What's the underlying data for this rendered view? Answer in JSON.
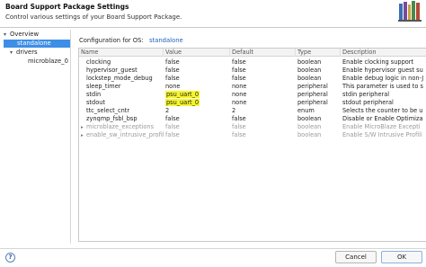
{
  "header": {
    "title": "Board Support Package Settings",
    "subtitle": "Control various settings of your Board Support Package.",
    "logo_icon": "books-stack-icon"
  },
  "tree": {
    "items": [
      {
        "label": "Overview",
        "level": 0,
        "expanded": true
      },
      {
        "label": "standalone",
        "level": 1,
        "selected": true
      },
      {
        "label": "drivers",
        "level": 1,
        "expanded": true
      },
      {
        "label": "microblaze_0",
        "level": 2
      }
    ]
  },
  "config": {
    "label": "Configuration for OS:",
    "value": "standalone"
  },
  "table": {
    "columns": [
      "Name",
      "Value",
      "Default",
      "Type",
      "Description"
    ],
    "rows": [
      {
        "name": "clocking",
        "value": "false",
        "default": "false",
        "type": "boolean",
        "description": "Enable clocking support"
      },
      {
        "name": "hypervisor_guest",
        "value": "false",
        "default": "false",
        "type": "boolean",
        "description": "Enable hypervisor guest su"
      },
      {
        "name": "lockstep_mode_debug",
        "value": "false",
        "default": "false",
        "type": "boolean",
        "description": "Enable debug logic in non-J"
      },
      {
        "name": "sleep_timer",
        "value": "none",
        "default": "none",
        "type": "peripheral",
        "description": "This parameter is used to s"
      },
      {
        "name": "stdin",
        "value": "psu_uart_0",
        "default": "none",
        "type": "peripheral",
        "description": "stdin peripheral"
      },
      {
        "name": "stdout",
        "value": "psu_uart_0",
        "default": "none",
        "type": "peripheral",
        "description": "stdout peripheral"
      },
      {
        "name": "ttc_select_cntr",
        "value": "2",
        "default": "2",
        "type": "enum",
        "description": "Selects the counter to be u"
      },
      {
        "name": "zynqmp_fsbl_bsp",
        "value": "false",
        "default": "false",
        "type": "boolean",
        "description": "Disable or Enable Optimiza"
      },
      {
        "name": "microblaze_exceptions",
        "value": "false",
        "default": "false",
        "type": "boolean",
        "description": "Enable MicroBlaze Excepti"
      },
      {
        "name": "enable_sw_intrusive_profiling",
        "value": "false",
        "default": "false",
        "type": "boolean",
        "description": "Enable S/W Intrusive Profili"
      }
    ]
  },
  "footer": {
    "help_label": "?",
    "cancel_label": "Cancel",
    "ok_label": "OK"
  },
  "colors": {
    "selection": "#3d8ee6",
    "highlight": "#f6f62a",
    "link": "#1f5fbf"
  }
}
